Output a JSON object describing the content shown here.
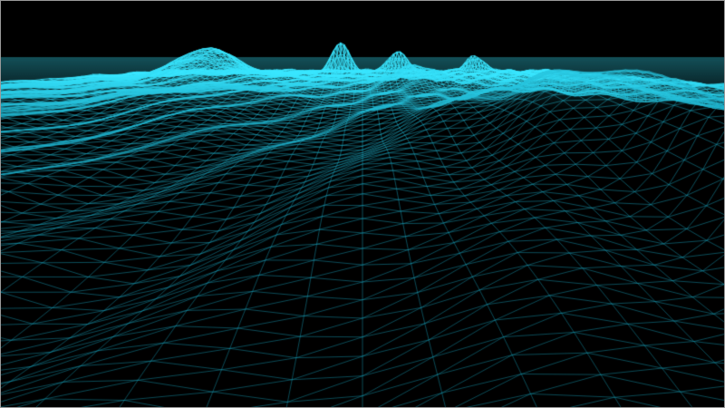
{
  "scene": {
    "type": "wireframe-terrain",
    "colors": {
      "background": "#000000",
      "wire_far": "#38e6ff",
      "wire_near": "#1aa9c4",
      "frame_border": "#9a9a9a"
    },
    "visible_text": []
  }
}
